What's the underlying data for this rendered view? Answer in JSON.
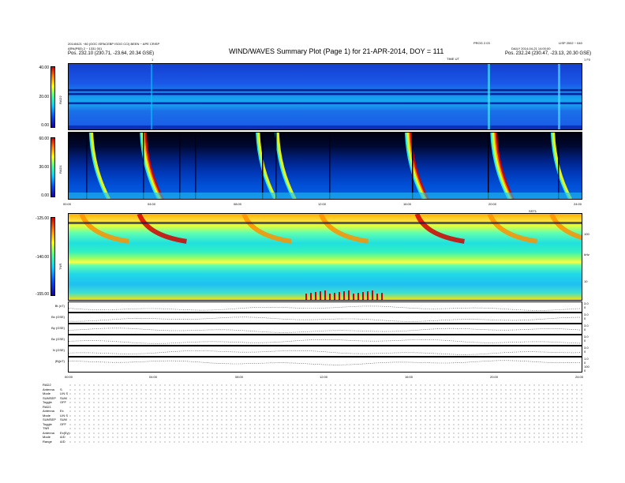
{
  "header": {
    "title": "WIND/WAVES Summary Plot (Page 1) for 21-APR-2014, DOY = 111",
    "left_line1": "20140421 ~80 (OOC ISPACEBP ISOO CCI) BEEN ~ APE CRISP",
    "left_line2": "ARN(PB3) 2 ~ 1331 001",
    "left_pos": "Pos.    232.10 (230.71, -23.64, 20.34 GSE)",
    "right_top_1": "PROG 2.03",
    "right_top_2": "LISP 2002 ~ 040",
    "right_line": "DAILY 2014-04-21 14:00:00",
    "right_pos": "Pos.    232.24 (230.47, -23.13, 20.30 GSE)",
    "time_unit_label": "TIME UT",
    "corner_left": "1",
    "corner_right": "1 F0"
  },
  "colors": {
    "background_dark": "#0a1a6e",
    "background_mid": "#1448d8",
    "hot": "#d40000",
    "warm": "#ffd400",
    "cool": "#22e0c8"
  },
  "chart_data": [
    {
      "type": "heatmap",
      "name": "RAD2",
      "ylabel": "RAD2",
      "yticks": [
        "40.00",
        "20.00",
        "0.00"
      ],
      "x_ticks": [
        "00:00",
        "04:00",
        "08:00",
        "12:00",
        "16:00",
        "20:00",
        "24:00"
      ],
      "xlim": [
        0,
        24
      ]
    },
    {
      "type": "heatmap",
      "name": "RAD1",
      "ylabel": "RAD1",
      "yticks": [
        "60.00",
        "30.00",
        "0.00"
      ],
      "x_ticks": [
        "00:00",
        "04:00",
        "08:00",
        "12:00",
        "16:00",
        "20:00",
        "24:00"
      ],
      "xlim": [
        0,
        24
      ],
      "bursts_hours": [
        1.0,
        3.4,
        8.8,
        9.7,
        15.8,
        19.8,
        22.6
      ]
    },
    {
      "type": "heatmap",
      "name": "TNR",
      "ylabel": "TNR",
      "yticks": [
        "-125.00",
        "-140.00",
        "-155.00"
      ],
      "right_ticks": [
        "100",
        "10"
      ],
      "right_unit": "kHz",
      "x_ticks": [
        "00:00",
        "04:00",
        "08:00",
        "12:00",
        "16:00",
        "20:00",
        "24:00"
      ],
      "xlim": [
        0,
        24
      ],
      "extra_label": "SST1"
    },
    {
      "type": "line",
      "panels": [
        {
          "label": "Bt (nT)",
          "right_ticks": [
            "3.0",
            "0"
          ]
        },
        {
          "label": "Bx (GSE)",
          "right_ticks": [
            "3.0",
            "0"
          ]
        },
        {
          "label": "By (GSE)",
          "right_ticks": [
            "3.0",
            "0"
          ]
        },
        {
          "label": "Bz (GSE)",
          "right_ticks": [
            "3.0",
            "0"
          ]
        },
        {
          "label": "N (GSE)",
          "right_ticks": [
            "3.0",
            "0"
          ]
        },
        {
          "label": "|B|(nT)",
          "right_ticks": [
            "1.0",
            "0",
            "100",
            "0"
          ]
        }
      ],
      "x_ticks": [
        "00:00",
        "04:00",
        "08:00",
        "12:00",
        "16:00",
        "20:00",
        "24:00"
      ]
    }
  ],
  "summary": {
    "labels": [
      "RAD2",
      "Antenna",
      "Mode",
      "SUMSEP",
      "Toggle",
      "RAD1",
      "Antenna",
      "Mode",
      "SUMSEP",
      "Toggle",
      "TNR",
      "Antenna",
      "Mode",
      "Range"
    ],
    "values": [
      "",
      "S",
      "LIN S",
      "SUM",
      "OFF",
      "",
      "Ex",
      "LIN S",
      "SUM",
      "OFF",
      "",
      "Ex(Ey)",
      "A/D",
      "A/D"
    ]
  }
}
